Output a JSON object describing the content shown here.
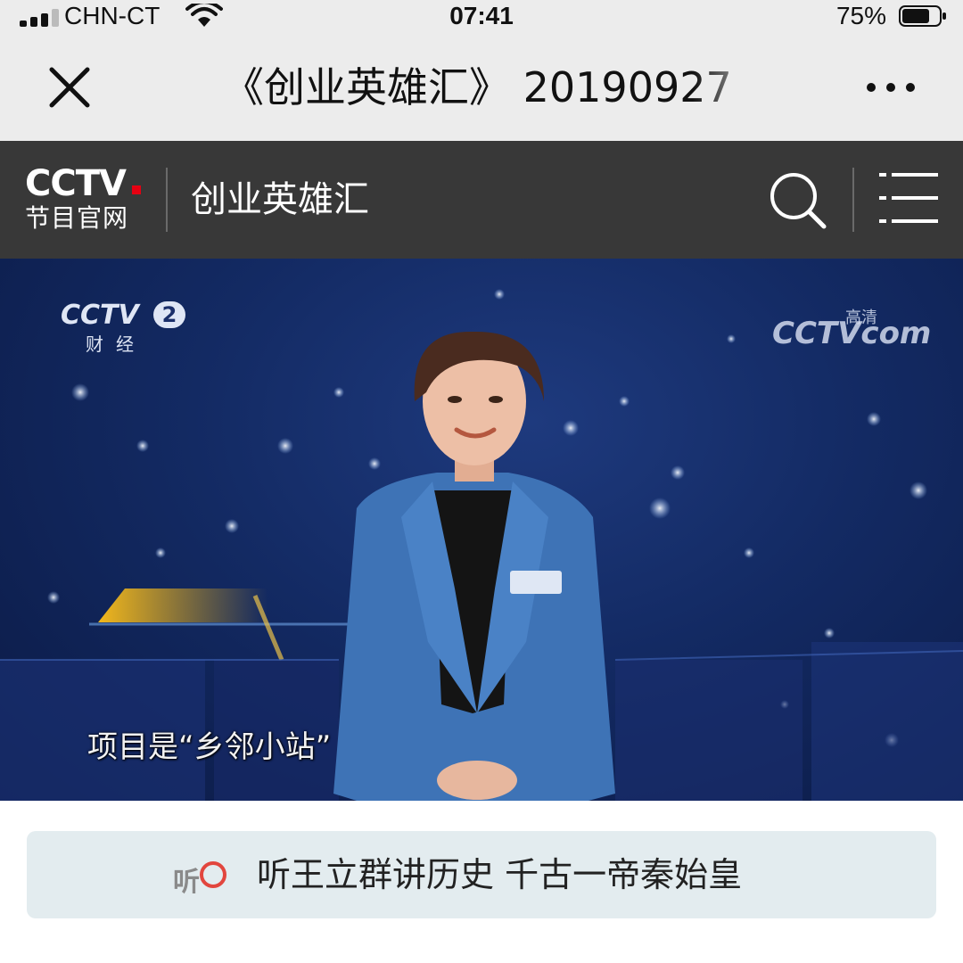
{
  "status_bar": {
    "carrier": "CHN-CT",
    "time": "07:41",
    "battery_percent": "75%",
    "battery_level": 0.75
  },
  "titlebar": {
    "title": "《创业英雄汇》 20190927",
    "close_icon": "close-icon",
    "more_icon": "more-icon"
  },
  "site_header": {
    "logo_text": "CCTV",
    "logo_sub": "节目官网",
    "program_name": "创业英雄汇",
    "search_icon": "search-icon",
    "menu_icon": "menu-icon",
    "logo_red": "#e60012"
  },
  "video": {
    "channel_logo": "CCTV",
    "channel_number": "2",
    "channel_name": "财经",
    "watermark": "CCTV",
    "watermark_suffix": "com",
    "watermark_top": "高清",
    "subtitle": "项目是“乡邻小站”"
  },
  "banner": {
    "icon_text": "听",
    "text": "听王立群讲历史 千古一帝秦始皇"
  }
}
